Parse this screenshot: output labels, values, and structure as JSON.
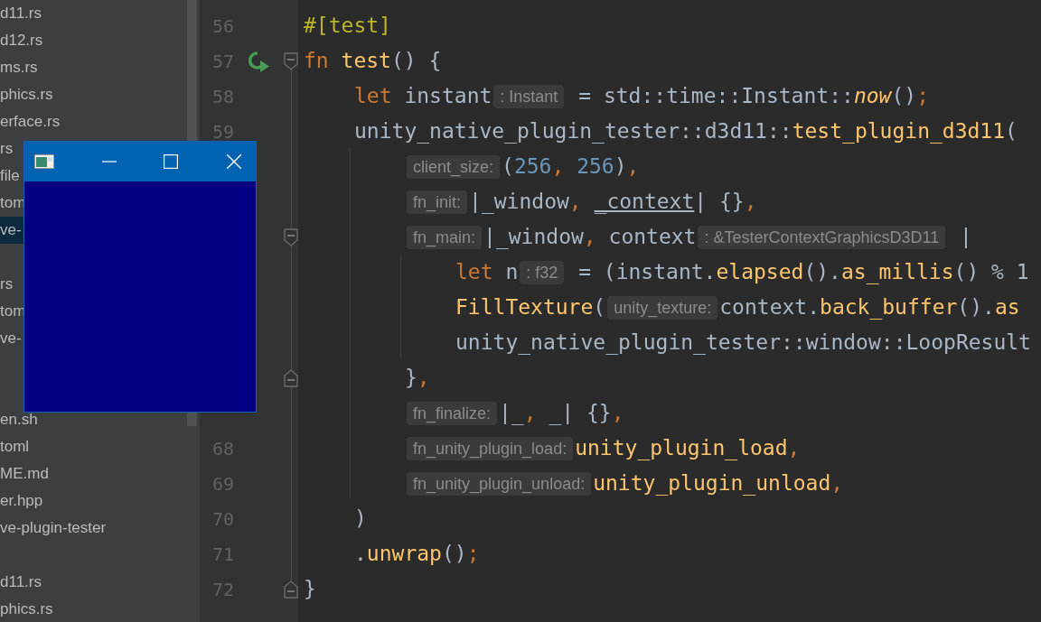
{
  "sidebar": {
    "items": [
      {
        "label": "d11.rs",
        "selected": false
      },
      {
        "label": "d12.rs",
        "selected": false
      },
      {
        "label": "ms.rs",
        "selected": false
      },
      {
        "label": "phics.rs",
        "selected": false
      },
      {
        "label": "erface.rs",
        "selected": false
      },
      {
        "label": "rs",
        "selected": false
      },
      {
        "label": "file",
        "selected": false
      },
      {
        "label": "tom",
        "selected": false
      },
      {
        "label": "ve-",
        "selected": true
      },
      {
        "selected": false
      },
      {
        "label": "rs",
        "selected": false
      },
      {
        "label": "tom",
        "selected": false
      },
      {
        "label": "ve-",
        "selected": false
      },
      {
        "selected": false
      },
      {
        "selected": false
      },
      {
        "label": "en.sh",
        "selected": false
      },
      {
        "label": "toml",
        "selected": false
      },
      {
        "label": "ME.md",
        "selected": false
      },
      {
        "label": "er.hpp",
        "selected": false
      },
      {
        "label": "ve-plugin-tester",
        "selected": false
      },
      {
        "selected": false
      },
      {
        "label": "d11.rs",
        "selected": false
      },
      {
        "label": "phics.rs",
        "selected": false
      }
    ]
  },
  "editor": {
    "lines": [
      {
        "number": "56",
        "tokens": [
          {
            "kind": "attr",
            "text": "#[test]"
          }
        ]
      },
      {
        "number": "57",
        "run": true,
        "fold_start": true,
        "tokens": [
          {
            "kind": "kw",
            "text": "fn"
          },
          {
            "kind": "fn",
            "text": " test"
          },
          {
            "kind": "plain",
            "text": "() {"
          }
        ],
        "children": [
          {
            "number": "58",
            "tokens": [
              {
                "kind": "kw",
                "text": "let"
              },
              {
                "kind": "plain",
                "text": " instant"
              },
              {
                "kind": "hint",
                "text": ": Instant"
              },
              {
                "kind": "plain",
                "text": " = std::time::Instant::"
              },
              {
                "kind": "italic",
                "text": "now"
              },
              {
                "kind": "plain",
                "text": "()"
              },
              {
                "kind": "punct",
                "text": ";"
              }
            ]
          },
          {
            "number": "59",
            "tokens": [
              {
                "kind": "plain",
                "text": "unity_native_plugin_tester::d3d11::"
              },
              {
                "kind": "fn",
                "text": "test_plugin_d3d11"
              },
              {
                "kind": "plain",
                "text": "("
              }
            ],
            "children": [
              {
                "tokens": [
                  {
                    "kind": "hint",
                    "text": "client_size:"
                  },
                  {
                    "kind": "plain",
                    "text": "("
                  },
                  {
                    "kind": "num",
                    "text": "256"
                  },
                  {
                    "kind": "punct",
                    "text": ", "
                  },
                  {
                    "kind": "num",
                    "text": "256"
                  },
                  {
                    "kind": "plain",
                    "text": ")"
                  },
                  {
                    "kind": "punct",
                    "text": ","
                  }
                ]
              },
              {
                "tokens": [
                  {
                    "kind": "hint",
                    "text": "fn_init:"
                  },
                  {
                    "kind": "plain",
                    "text": "|_window"
                  },
                  {
                    "kind": "punct",
                    "text": ", "
                  },
                  {
                    "kind": "underline",
                    "text": "_context"
                  },
                  {
                    "kind": "plain",
                    "text": "| {}"
                  },
                  {
                    "kind": "punct",
                    "text": ","
                  }
                ]
              },
              {
                "fold_start": true,
                "tokens": [
                  {
                    "kind": "hint",
                    "text": "fn_main:"
                  },
                  {
                    "kind": "plain",
                    "text": "|_window"
                  },
                  {
                    "kind": "punct",
                    "text": ", "
                  },
                  {
                    "kind": "plain",
                    "text": "context"
                  },
                  {
                    "kind": "hint",
                    "text": ": &TesterContextGraphicsD3D11"
                  },
                  {
                    "kind": "plain",
                    "text": " |"
                  }
                ],
                "children": [
                  {
                    "tokens": [
                      {
                        "kind": "kw",
                        "text": "let"
                      },
                      {
                        "kind": "plain",
                        "text": " n"
                      },
                      {
                        "kind": "hint",
                        "text": ": f32"
                      },
                      {
                        "kind": "plain",
                        "text": " = (instant."
                      },
                      {
                        "kind": "fn",
                        "text": "elapsed"
                      },
                      {
                        "kind": "plain",
                        "text": "()."
                      },
                      {
                        "kind": "fn",
                        "text": "as_millis"
                      },
                      {
                        "kind": "plain",
                        "text": "() % 1"
                      }
                    ]
                  },
                  {
                    "tokens": [
                      {
                        "kind": "fn",
                        "text": "FillTexture"
                      },
                      {
                        "kind": "plain",
                        "text": "("
                      },
                      {
                        "kind": "hint",
                        "text": "unity_texture:"
                      },
                      {
                        "kind": "plain",
                        "text": "context."
                      },
                      {
                        "kind": "fn",
                        "text": "back_buffer"
                      },
                      {
                        "kind": "plain",
                        "text": "()."
                      },
                      {
                        "kind": "fn",
                        "text": "as"
                      }
                    ]
                  },
                  {
                    "tokens": [
                      {
                        "kind": "plain",
                        "text": "unity_native_plugin_tester::window::LoopResult"
                      }
                    ]
                  }
                ]
              },
              {
                "fold_end": true,
                "tokens": [
                  {
                    "kind": "plain",
                    "text": "}"
                  },
                  {
                    "kind": "punct",
                    "text": ","
                  }
                ]
              },
              {
                "tokens": [
                  {
                    "kind": "hint",
                    "text": "fn_finalize:"
                  },
                  {
                    "kind": "plain",
                    "text": "|_"
                  },
                  {
                    "kind": "punct",
                    "text": ", "
                  },
                  {
                    "kind": "plain",
                    "text": "_| {}"
                  },
                  {
                    "kind": "punct",
                    "text": ","
                  }
                ]
              },
              {
                "number": "68",
                "tokens": [
                  {
                    "kind": "hint",
                    "text": "fn_unity_plugin_load:"
                  },
                  {
                    "kind": "fn",
                    "text": "unity_plugin_load"
                  },
                  {
                    "kind": "punct",
                    "text": ","
                  }
                ]
              },
              {
                "number": "69",
                "tokens": [
                  {
                    "kind": "hint",
                    "text": "fn_unity_plugin_unload:"
                  },
                  {
                    "kind": "fn",
                    "text": "unity_plugin_unload"
                  },
                  {
                    "kind": "punct",
                    "text": ","
                  }
                ]
              }
            ]
          },
          {
            "number": "70",
            "tokens": [
              {
                "kind": "plain",
                "text": ")"
              }
            ]
          },
          {
            "number": "71",
            "tokens": [
              {
                "kind": "plain",
                "text": "."
              },
              {
                "kind": "fn",
                "text": "unwrap"
              },
              {
                "kind": "plain",
                "text": "()"
              },
              {
                "kind": "punct",
                "text": ";"
              }
            ]
          }
        ]
      },
      {
        "number": "72",
        "fold_end": true,
        "tokens": [
          {
            "kind": "plain",
            "text": "}"
          }
        ]
      }
    ]
  },
  "popup_window": {
    "kind": "native_window"
  }
}
